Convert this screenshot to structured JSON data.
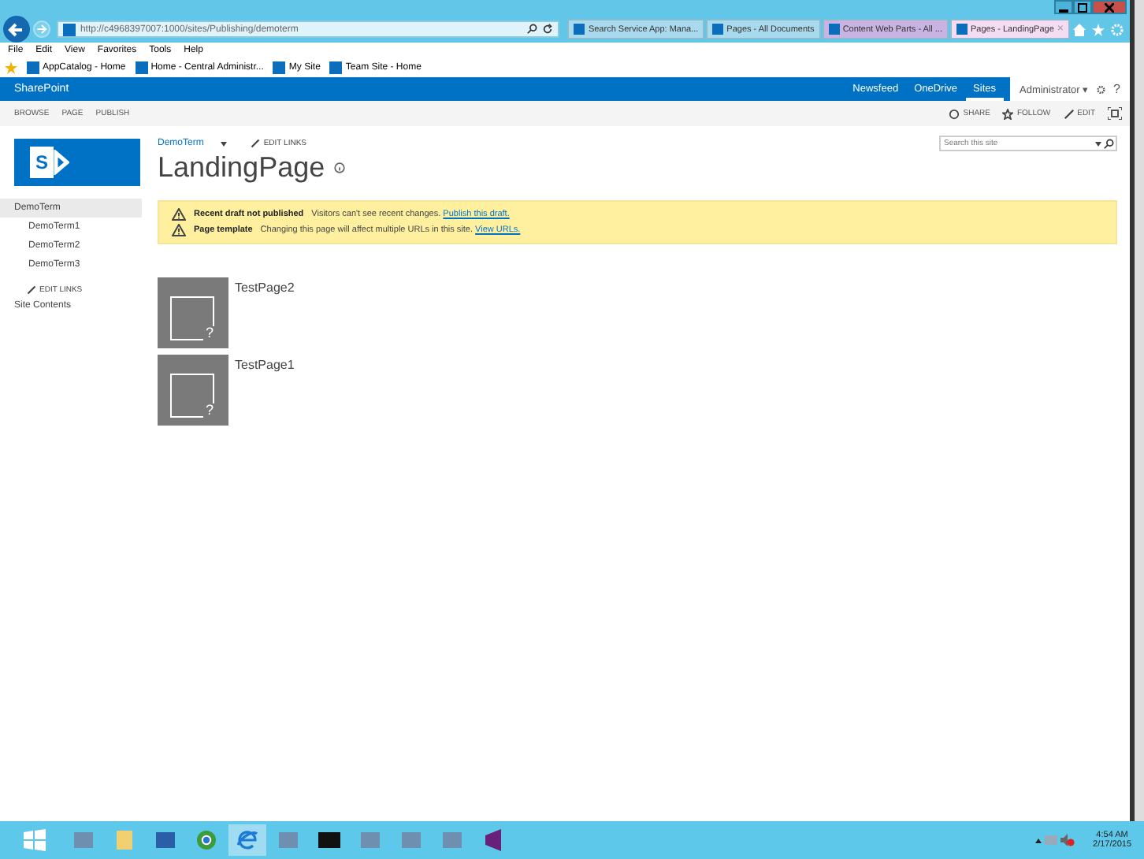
{
  "browser": {
    "address": "http://c4968397007:1000/sites/Publishing/demoterm",
    "tabs": [
      {
        "label": "Search Service App: Mana...",
        "selected": false,
        "color": "#a9d9ec"
      },
      {
        "label": "Pages - All Documents",
        "selected": false,
        "color": "#a9d9ec"
      },
      {
        "label": "Content Web Parts - All ...",
        "selected": false,
        "color": "#c9b3e3"
      },
      {
        "label": "Pages - LandingPage",
        "selected": true,
        "color": "#f4dcf2"
      }
    ],
    "close_tab": "×",
    "menu": [
      "File",
      "Edit",
      "View",
      "Favorites",
      "Tools",
      "Help"
    ],
    "favorites": [
      "AppCatalog - Home",
      "Home - Central Administr...",
      "My Site",
      "Team Site - Home"
    ]
  },
  "suite_bar": {
    "brand": "SharePoint",
    "links": [
      {
        "label": "Newsfeed",
        "selected": false
      },
      {
        "label": "OneDrive",
        "selected": false
      },
      {
        "label": "Sites",
        "selected": true
      }
    ],
    "user": "Administrator",
    "user_caret": "▾",
    "help": "?"
  },
  "logo": "S",
  "ribbon": {
    "tabs": [
      "BROWSE",
      "PAGE",
      "PUBLISH"
    ],
    "actions": [
      "SHARE",
      "FOLLOW",
      "EDIT"
    ]
  },
  "header": {
    "breadcrumb": "DemoTerm",
    "edit_links": "EDIT LINKS",
    "title": "LandingPage",
    "search": {
      "placeholder": "Search this site"
    }
  },
  "quick_launch": {
    "items": [
      {
        "label": "DemoTerm",
        "selected": true,
        "children": [
          {
            "label": "DemoTerm1",
            "selected": false
          },
          {
            "label": "DemoTerm2",
            "selected": false
          },
          {
            "label": "DemoTerm3",
            "selected": false
          }
        ]
      }
    ],
    "edit_links": "EDIT LINKS",
    "site_contents": "Site Contents"
  },
  "status": [
    {
      "title": "Recent draft not published",
      "text": "Visitors can't see recent changes.",
      "link": "Publish this draft."
    },
    {
      "title": "Page template",
      "text": "Changing this page will affect multiple URLs in this site.",
      "link": "View URLs."
    }
  ],
  "pages": [
    {
      "title": "TestPage2",
      "mark": "?"
    },
    {
      "title": "TestPage1",
      "mark": "?"
    }
  ],
  "taskbar": {
    "time": "4:54 AM",
    "date": "2/17/2015"
  }
}
